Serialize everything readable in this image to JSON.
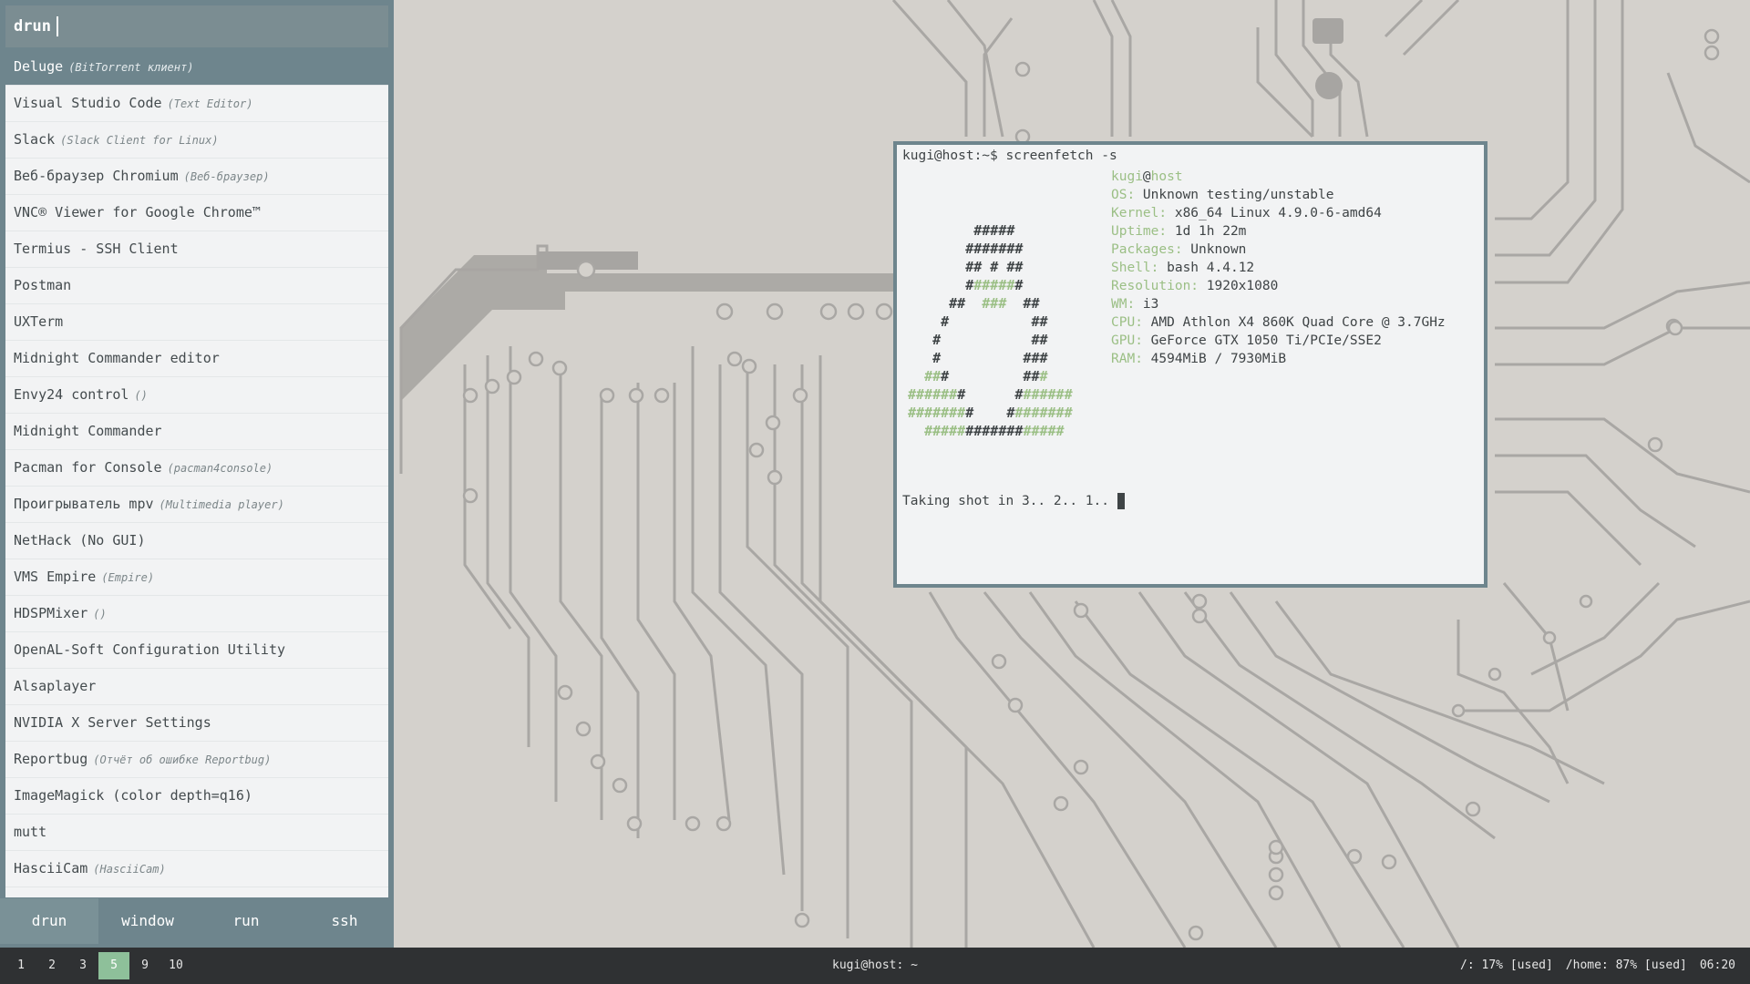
{
  "rofi": {
    "prompt": "drun",
    "entries": [
      {
        "name": "Deluge",
        "comment": "(BitTorrent клиент)"
      },
      {
        "name": "Visual Studio Code",
        "comment": "(Text Editor)"
      },
      {
        "name": "Slack",
        "comment": "(Slack Client for Linux)"
      },
      {
        "name": "Веб-браузер Chromium",
        "comment": "(Веб-браузер)"
      },
      {
        "name": "VNC® Viewer for Google Chrome™",
        "comment": ""
      },
      {
        "name": "Termius - SSH Client",
        "comment": ""
      },
      {
        "name": "Postman",
        "comment": ""
      },
      {
        "name": "UXTerm",
        "comment": ""
      },
      {
        "name": "Midnight Commander editor",
        "comment": ""
      },
      {
        "name": "Envy24 control",
        "comment": "()"
      },
      {
        "name": "Midnight Commander",
        "comment": ""
      },
      {
        "name": "Pacman for Console",
        "comment": "(pacman4console)"
      },
      {
        "name": "Проигрыватель mpv",
        "comment": "(Multimedia player)"
      },
      {
        "name": "NetHack (No GUI)",
        "comment": ""
      },
      {
        "name": "VMS Empire",
        "comment": "(Empire)"
      },
      {
        "name": "HDSPMixer",
        "comment": "()"
      },
      {
        "name": "OpenAL-Soft Configuration Utility",
        "comment": ""
      },
      {
        "name": "Alsaplayer",
        "comment": ""
      },
      {
        "name": "NVIDIA X Server Settings",
        "comment": ""
      },
      {
        "name": "Reportbug",
        "comment": "(Отчёт об ошибке Reportbug)"
      },
      {
        "name": "ImageMagick (color depth=q16)",
        "comment": ""
      },
      {
        "name": "mutt",
        "comment": ""
      },
      {
        "name": "HasciiCam",
        "comment": "(HasciiCam)"
      }
    ],
    "modes": [
      "drun",
      "window",
      "run",
      "ssh"
    ]
  },
  "terminal": {
    "command_line": "kugi@host:~$ screenfetch -s",
    "user": "kugi",
    "at": "@",
    "host": "host",
    "info": [
      {
        "key": "OS:",
        "value": "Unknown testing/unstable"
      },
      {
        "key": "Kernel:",
        "value": "x86_64 Linux 4.9.0-6-amd64"
      },
      {
        "key": "Uptime:",
        "value": "1d 1h 22m"
      },
      {
        "key": "Packages:",
        "value": "Unknown"
      },
      {
        "key": "Shell:",
        "value": "bash 4.4.12"
      },
      {
        "key": "Resolution:",
        "value": "1920x1080"
      },
      {
        "key": "WM:",
        "value": "i3"
      },
      {
        "key": "CPU:",
        "value": "AMD Athlon X4 860K Quad Core @ 3.7GHz"
      },
      {
        "key": "GPU:",
        "value": "GeForce GTX 1050 Ti/PCIe/SSE2"
      },
      {
        "key": "RAM:",
        "value": "4594MiB / 7930MiB"
      }
    ],
    "logo_lines": [
      "        #####",
      "       #######",
      "       ## # ##",
      "       #[g]#####[/g]#",
      "     ##  [g]###[/g]  ##",
      "    #          ##",
      "   #           ##",
      "   #          ###",
      "  [g]##[/g]#         ##[g]#[/g]",
      "[g]######[/g]#      #[g]######[/g]",
      "[g]#######[/g]#    #[g]#######[/g]",
      "  [g]#####[/g]#######[g]#####[/g]"
    ],
    "prompt_line": "Taking shot in 3.. 2.. 1.. "
  },
  "bar": {
    "workspaces": [
      "1",
      "2",
      "3",
      "5",
      "9",
      "10"
    ],
    "focused_workspace": "5",
    "title": "kugi@host: ~",
    "status": [
      "/: 17% [used]",
      "/home: 87% [used]",
      "06:20"
    ]
  },
  "colors": {
    "accent": "#6e858d",
    "terminal_green": "#9bbf85",
    "workspace_focused": "#8ec09a",
    "bar_bg": "#2f3133",
    "wallpaper_bg": "#d4d1cc",
    "circuit_trace": "#a7a5a2"
  }
}
